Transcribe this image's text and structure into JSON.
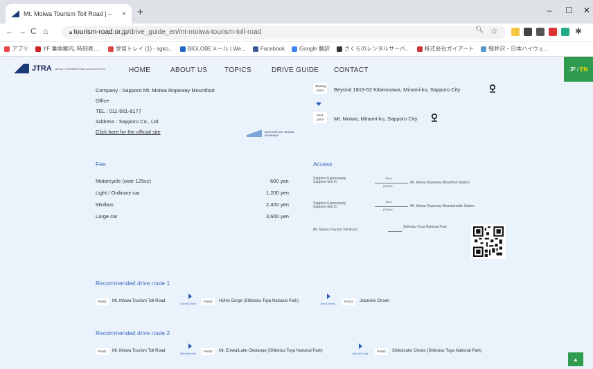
{
  "browser": {
    "tab_title": "Mt. Moiwa Tourism Toll Road | –",
    "tab_close": "×",
    "new_tab": "+",
    "win_min": "–",
    "win_max": "☐",
    "win_close": "✕",
    "url_host": "tourism-road.or.jp",
    "url_path": "/drive_guide_en/mt-moiwa-tourism-toll-road",
    "bookmarks": [
      "アプリ",
      "YF 乗換案内, 時刻表, ...",
      "受信トレイ (1) - sgko...",
      "BIGLOBEメール | We...",
      "Facebook",
      "Google 翻訳",
      "さくらのレンタルサーバ...",
      "株式会社ガイアート",
      "軽井沢・日本ハイウェ..."
    ]
  },
  "header": {
    "logo": "JTRA",
    "logo_sub": "JAPAN TOURISM ROAD ASSOCIATION",
    "menu": [
      "HOME",
      "ABOUT US",
      "TOPICS",
      "DRIVE GUIDE",
      "CONTACT"
    ],
    "lang_jp": "JP /",
    "lang_en": "EN"
  },
  "company": {
    "name": "Company : Sapporo Mt. Moiwa Ropeway Mountfoot",
    "office": "Office",
    "tel": "TEL : 011-561-8177",
    "address": "Address : Sapporo Co., Ltd",
    "link": "Click here for the official site",
    "logo_text": "SAPPORO MT. MOIWA ROPEWAY"
  },
  "route": {
    "start_label": "Starting point",
    "start_value": "Beyond 1819-52 Kitanosawa, Minami-ku, Sapporo City",
    "end_label": "End point",
    "end_value": "Mt. Moiwa, Minami-ku, Sapporo City"
  },
  "fee": {
    "heading": "Fee",
    "rows": [
      {
        "label": "Motorcycle (over 125cc)",
        "price": "600 yen"
      },
      {
        "label": "Light / Ordinary car",
        "price": "1,200 yen"
      },
      {
        "label": "Minibus",
        "price": "2,400 yen"
      },
      {
        "label": "Large car",
        "price": "3,600 yen"
      }
    ]
  },
  "access": {
    "heading": "Access",
    "rows": [
      {
        "from": "Sapporo Expressway Sapporo-kita IC",
        "dist": "18km",
        "time": "(33min)",
        "to": "Mt. Moiwa Ropeway Mountfoot Station"
      },
      {
        "from": "Sapporo Expressway Sapporo-kita IC",
        "dist": "19km",
        "time": "(22min)",
        "to": "Mt. Moiwa Ropeway Mountainside Station"
      },
      {
        "from": "Mt. Moiwa Tourism Toll Road",
        "dist": "",
        "time": "",
        "to": "Shikotsu-Toya National Park"
      }
    ]
  },
  "drive1": {
    "heading": "Recommended drive route 1",
    "p1_tag": "Point1",
    "p1": "Mt. Moiwa Tourism Toll Road",
    "seg1": "30km(37min)",
    "p2_tag": "Point2",
    "p2": "Hohei Gorge (Shikotsu-Toya National Park)",
    "seg2": "8km(10min)",
    "p3_tag": "Point3",
    "p3": "Jozankei Onsen"
  },
  "drive2": {
    "heading": "Recommended drive route 2",
    "p1_tag": "Point1",
    "p1": "Mt. Moiwa Tourism Toll Road",
    "seg1": "38km(46min)",
    "p2_tag": "Point2",
    "p2": "Mt. Eniwa/Lake Okotanpe (Shikotsu-Toya National Park)",
    "seg2": "18km(21min)",
    "p3_tag": "Point3",
    "p3": "Shikotsuko Onsen (Shikotsu-Toya National Park)"
  },
  "totop": "▲",
  "colors": {
    "accent": "#2e9b4f",
    "heading": "#3b6bb8",
    "page_bg": "#eaf2fc"
  }
}
